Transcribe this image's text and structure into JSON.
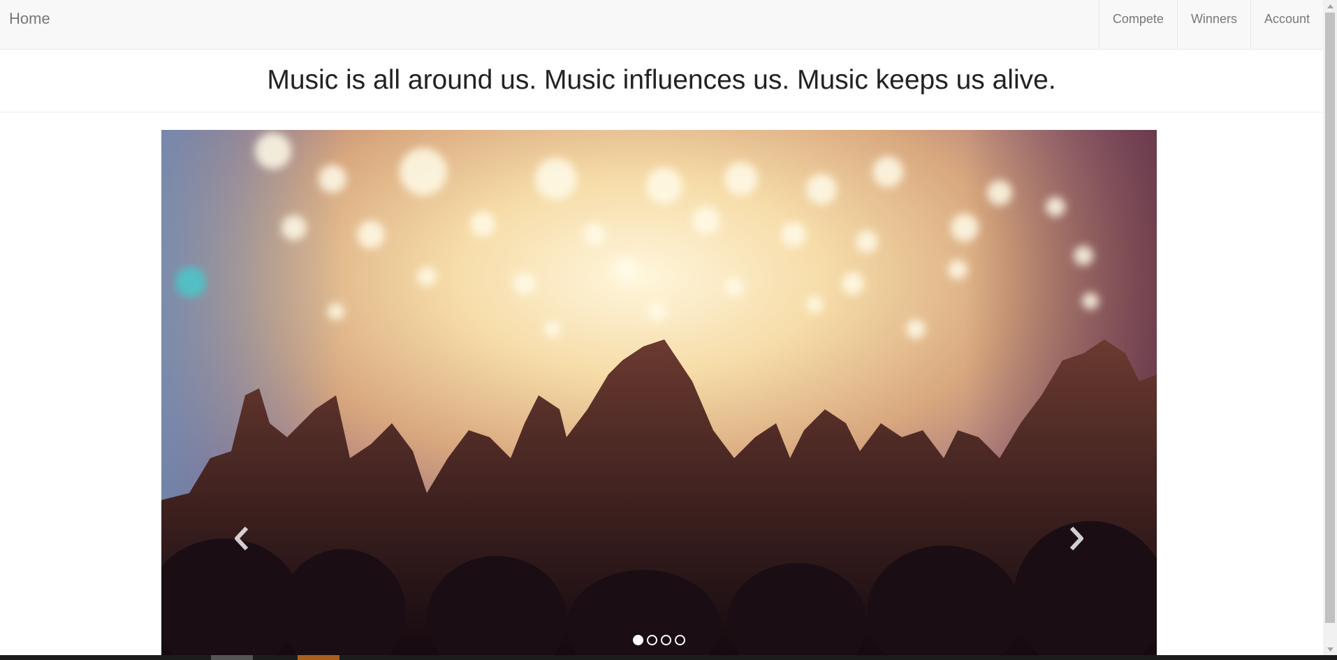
{
  "navbar": {
    "brand": "Home",
    "items": [
      {
        "label": "Compete"
      },
      {
        "label": "Winners"
      },
      {
        "label": "Account"
      }
    ]
  },
  "hero": {
    "tagline": "Music is all around us. Music influences us. Music keeps us alive."
  },
  "carousel": {
    "slide_description_icon": "concert-crowd-image",
    "slide_count": 4,
    "active_index": 0,
    "prev_icon": "chevron-left-icon",
    "next_icon": "chevron-right-icon"
  },
  "colors": {
    "navbar_bg": "#f8f8f8",
    "nav_text": "#777777",
    "heading_text": "#222222"
  }
}
